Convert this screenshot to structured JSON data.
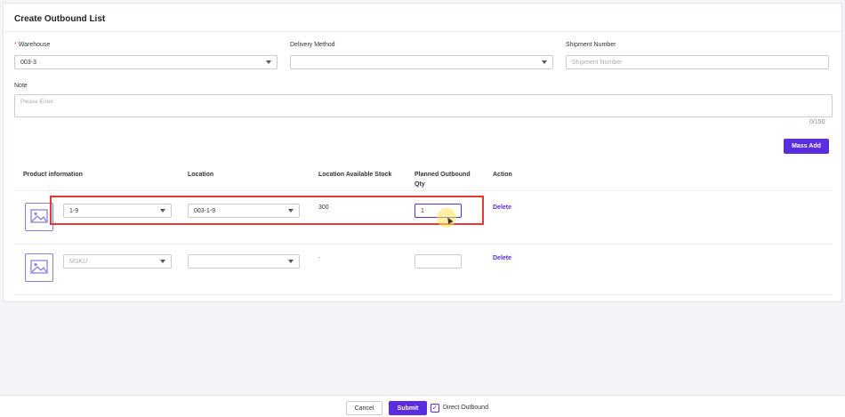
{
  "page": {
    "title": "Create Outbound List"
  },
  "form": {
    "warehouse": {
      "label": "Warehouse",
      "required_mark": "*",
      "value": "003-3"
    },
    "delivery_method": {
      "label": "Delivery Method",
      "value": ""
    },
    "shipment_number": {
      "label": "Shipment Number",
      "placeholder": "Shipment Number"
    },
    "note": {
      "label": "Note",
      "placeholder": "Please Enter",
      "counter": "0/150"
    }
  },
  "toolbar": {
    "mass_add_label": "Mass Add"
  },
  "table": {
    "headers": {
      "product": "Product information",
      "location": "Location",
      "stock": "Location Available Stock",
      "qty_line1": "Planned Outbound",
      "qty_line2": "Qty",
      "action": "Action"
    },
    "rows": [
      {
        "msku": "1-9",
        "location": "003-1-9",
        "stock": "300",
        "qty": "1",
        "action": "Delete"
      },
      {
        "msku_placeholder": "MSKU",
        "location": "",
        "stock": "-",
        "qty": "",
        "action": "Delete"
      }
    ]
  },
  "footer": {
    "cancel_label": "Cancel",
    "submit_label": "Submit",
    "direct_outbound_label": "Direct Outbound",
    "direct_outbound_checked": true
  },
  "colors": {
    "accent": "#5b2de0",
    "highlight": "#e53935",
    "required": "#e54545"
  }
}
